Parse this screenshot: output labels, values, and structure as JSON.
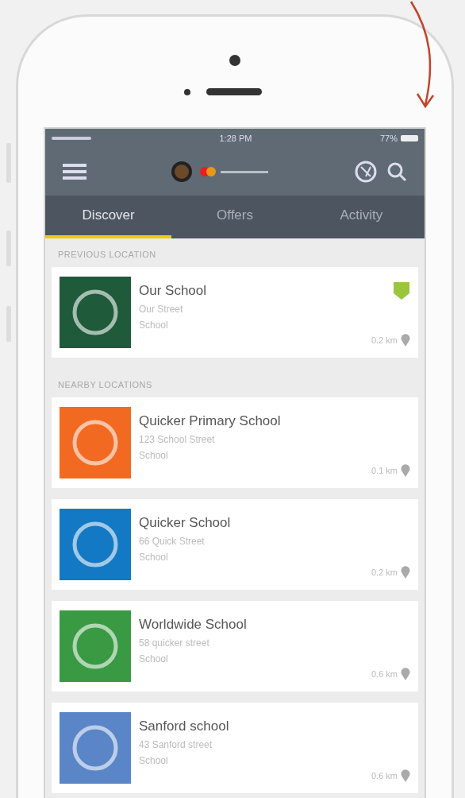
{
  "status_bar": {
    "time": "1:28 PM",
    "battery": "77%"
  },
  "tabs": [
    {
      "label": "Discover",
      "selected": true
    },
    {
      "label": "Offers",
      "selected": false
    },
    {
      "label": "Activity",
      "selected": false
    }
  ],
  "sections": [
    {
      "title": "PREVIOUS LOCATION",
      "items": [
        {
          "name": "Our School",
          "address": "Our Street",
          "category": "School",
          "distance": "0.2 km",
          "color": "#1f5a3a",
          "badge": true
        }
      ]
    },
    {
      "title": "NEARBY LOCATIONS",
      "items": [
        {
          "name": "Quicker Primary School",
          "address": "123 School Street",
          "category": "School",
          "distance": "0.1 km",
          "color": "#f26a21",
          "badge": false
        },
        {
          "name": "Quicker School",
          "address": "66 Quick Street",
          "category": "School",
          "distance": "0.2 km",
          "color": "#1479c4",
          "badge": false
        },
        {
          "name": "Worldwide School",
          "address": "58 quicker street",
          "category": "School",
          "distance": "0.6 km",
          "color": "#3a9a44",
          "badge": false
        },
        {
          "name": "Sanford school",
          "address": "43 Sanford street",
          "category": "School",
          "distance": "0.6 km",
          "color": "#5a86c8",
          "badge": false
        }
      ]
    }
  ]
}
